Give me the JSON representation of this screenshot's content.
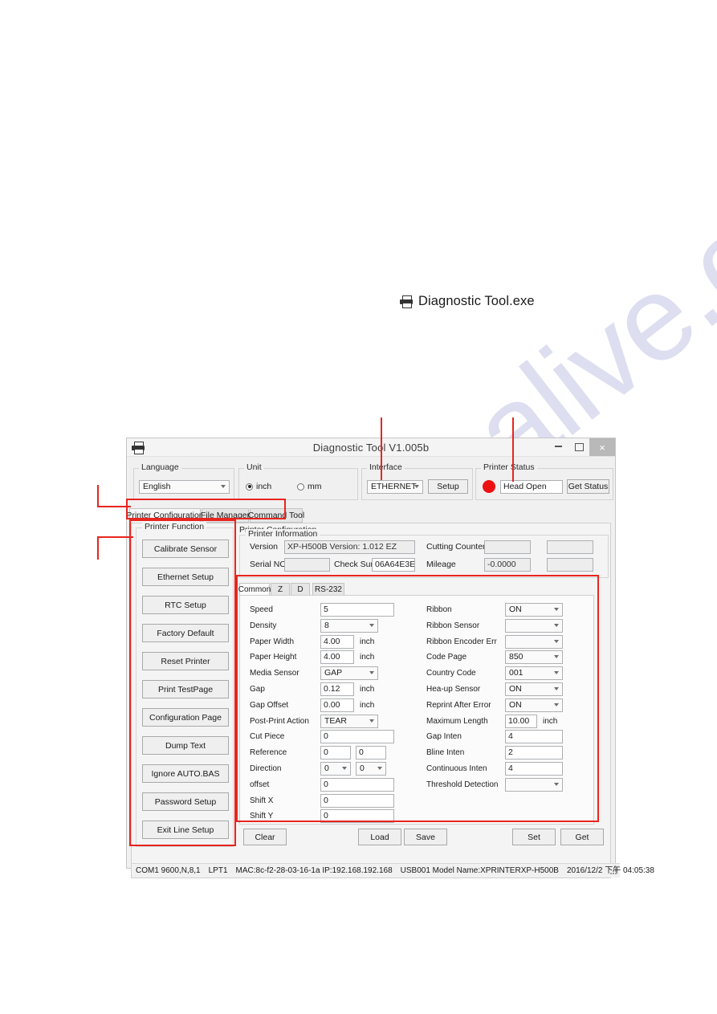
{
  "exe_caption": {
    "icon": "printer-icon",
    "label": "Diagnostic Tool.exe"
  },
  "window": {
    "title": "Diagnostic Tool V1.005b",
    "icon": "printer-icon",
    "controls": {
      "minimize": "–",
      "maximize": "□",
      "close": "×"
    }
  },
  "toolbar": {
    "language": {
      "legend": "Language",
      "value": "English"
    },
    "unit": {
      "legend": "Unit",
      "options": [
        "inch",
        "mm"
      ],
      "selected": "inch"
    },
    "interface": {
      "legend": "Interface",
      "value": "ETHERNET",
      "setup_label": "Setup"
    },
    "printer_status": {
      "legend": "Printer  Status",
      "led_color": "#ee1111",
      "value": "Head Open",
      "button_label": "Get Status"
    }
  },
  "tabs": [
    {
      "label": "Printer Configuration",
      "selected": true
    },
    {
      "label": "File Manager",
      "selected": false
    },
    {
      "label": "Command Tool",
      "selected": false
    }
  ],
  "printer_function": {
    "legend": "Printer  Function",
    "buttons": [
      "Calibrate Sensor",
      "Ethernet Setup",
      "RTC Setup",
      "Factory Default",
      "Reset Printer",
      "Print TestPage",
      "Configuration Page",
      "Dump Text",
      "Ignore AUTO.BAS",
      "Password Setup",
      "Exit Line Setup"
    ]
  },
  "printer_configuration": {
    "title": "Printer Configuration",
    "information": {
      "legend": "Printer Information",
      "version_label": "Version",
      "version_value": "XP-H500B Version: 1.012 EZ",
      "serial_label": "Serial NO",
      "serial_value": "",
      "checksum_label": "Check Sum",
      "checksum_value": "06A64E3E",
      "cutting_counter_label": "Cutting Counter",
      "cutting_counter_value": "",
      "cutting_counter_value2": "",
      "mileage_label": "Mileage",
      "mileage_value": "-0.0000",
      "mileage_value2": ""
    },
    "panel_tabs": [
      {
        "label": "Common",
        "selected": true
      },
      {
        "label": "Z",
        "selected": false
      },
      {
        "label": "D",
        "selected": false
      },
      {
        "label": "RS-232",
        "selected": false
      }
    ],
    "left_fields": [
      {
        "label": "Speed",
        "type": "text",
        "value": "5",
        "unit": ""
      },
      {
        "label": "Density",
        "type": "combo",
        "value": "8",
        "unit": ""
      },
      {
        "label": "Paper Width",
        "type": "text",
        "value": "4.00",
        "unit": "inch"
      },
      {
        "label": "Paper Height",
        "type": "text",
        "value": "4.00",
        "unit": "inch"
      },
      {
        "label": "Media Sensor",
        "type": "combo",
        "value": "GAP",
        "unit": ""
      },
      {
        "label": "Gap",
        "type": "text",
        "value": "0.12",
        "unit": "inch"
      },
      {
        "label": "Gap Offset",
        "type": "text",
        "value": "0.00",
        "unit": "inch"
      },
      {
        "label": "Post-Print  Action",
        "type": "combo",
        "value": "TEAR",
        "unit": ""
      },
      {
        "label": "Cut  Piece",
        "type": "text",
        "value": "0",
        "unit": ""
      },
      {
        "label": "Reference",
        "type": "pair-text",
        "value": "0",
        "value2": "0",
        "unit": ""
      },
      {
        "label": "Direction",
        "type": "pair-combo",
        "value": "0",
        "value2": "0",
        "unit": ""
      },
      {
        "label": "offset",
        "type": "text",
        "value": "0",
        "unit": ""
      },
      {
        "label": "Shift X",
        "type": "text",
        "value": "0",
        "unit": ""
      },
      {
        "label": "Shift Y",
        "type": "text",
        "value": "0",
        "unit": ""
      }
    ],
    "right_fields": [
      {
        "label": "Ribbon",
        "type": "combo",
        "value": "ON",
        "unit": ""
      },
      {
        "label": "Ribbon  Sensor",
        "type": "combo",
        "value": "",
        "unit": ""
      },
      {
        "label": "Ribbon Encoder Err",
        "type": "combo",
        "value": "",
        "unit": ""
      },
      {
        "label": "Code Page",
        "type": "combo",
        "value": "850",
        "unit": ""
      },
      {
        "label": "Country Code",
        "type": "combo",
        "value": "001",
        "unit": ""
      },
      {
        "label": "Hea-up  Sensor",
        "type": "combo",
        "value": "ON",
        "unit": ""
      },
      {
        "label": "Reprint After  Error",
        "type": "combo",
        "value": "ON",
        "unit": ""
      },
      {
        "label": "Maximum Length",
        "type": "text",
        "value": "10.00",
        "unit": "inch"
      },
      {
        "label": "Gap Inten",
        "type": "text",
        "value": "4",
        "unit": ""
      },
      {
        "label": "Bline  Inten",
        "type": "text",
        "value": "2",
        "unit": ""
      },
      {
        "label": "Continuous  Inten",
        "type": "text",
        "value": "4",
        "unit": ""
      },
      {
        "label": "Threshold  Detection",
        "type": "combo",
        "value": "",
        "unit": ""
      }
    ],
    "actions": [
      "Clear",
      "Load",
      "Save",
      "Set",
      "Get"
    ]
  },
  "status_bar": {
    "com": "COM1 9600,N,8,1",
    "lpt": "LPT1",
    "net": "MAC:8c-f2-28-03-16-1a  IP:192.168.192.168",
    "usb": "USB001  Model Name:XPRINTERXP-H500B",
    "datetime": "2016/12/2 下午 04:05:38"
  },
  "annotations": {
    "color": "#e8251f"
  },
  "watermark": {
    "text": "manualsalive.com"
  }
}
